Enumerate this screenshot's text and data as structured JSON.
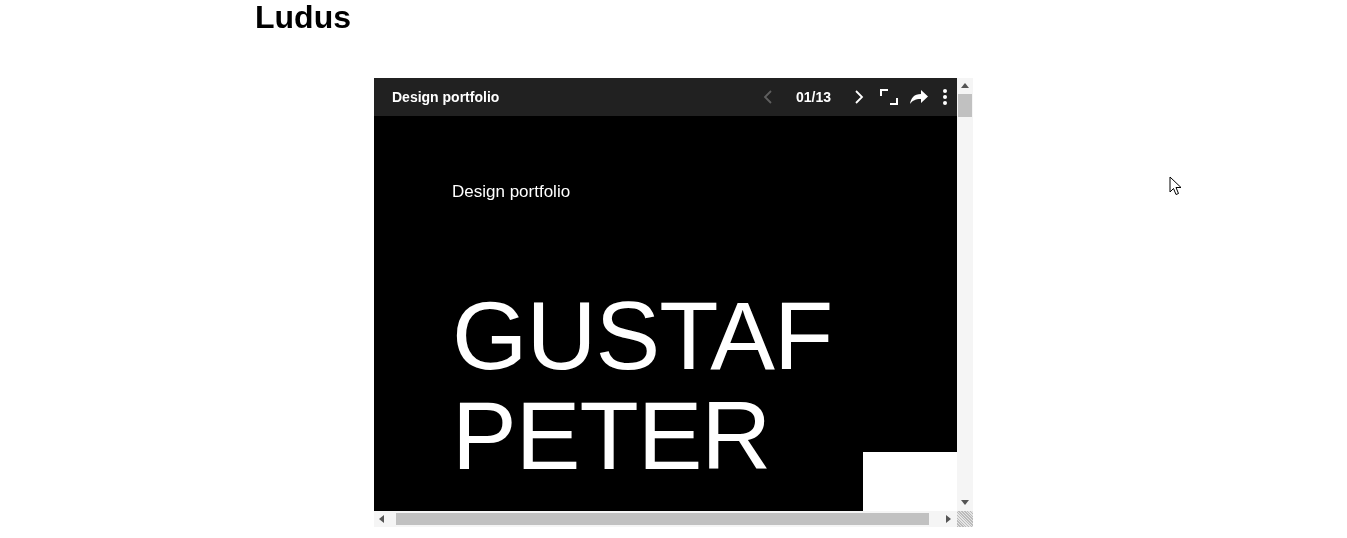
{
  "page_title": "Ludus",
  "viewer": {
    "title": "Design portfolio",
    "page": "01/13",
    "previous_disabled": true,
    "next_disabled": false
  },
  "slide": {
    "subtitle": "Design portfolio",
    "title_lines": [
      "GUSTAF",
      "PETER"
    ]
  }
}
